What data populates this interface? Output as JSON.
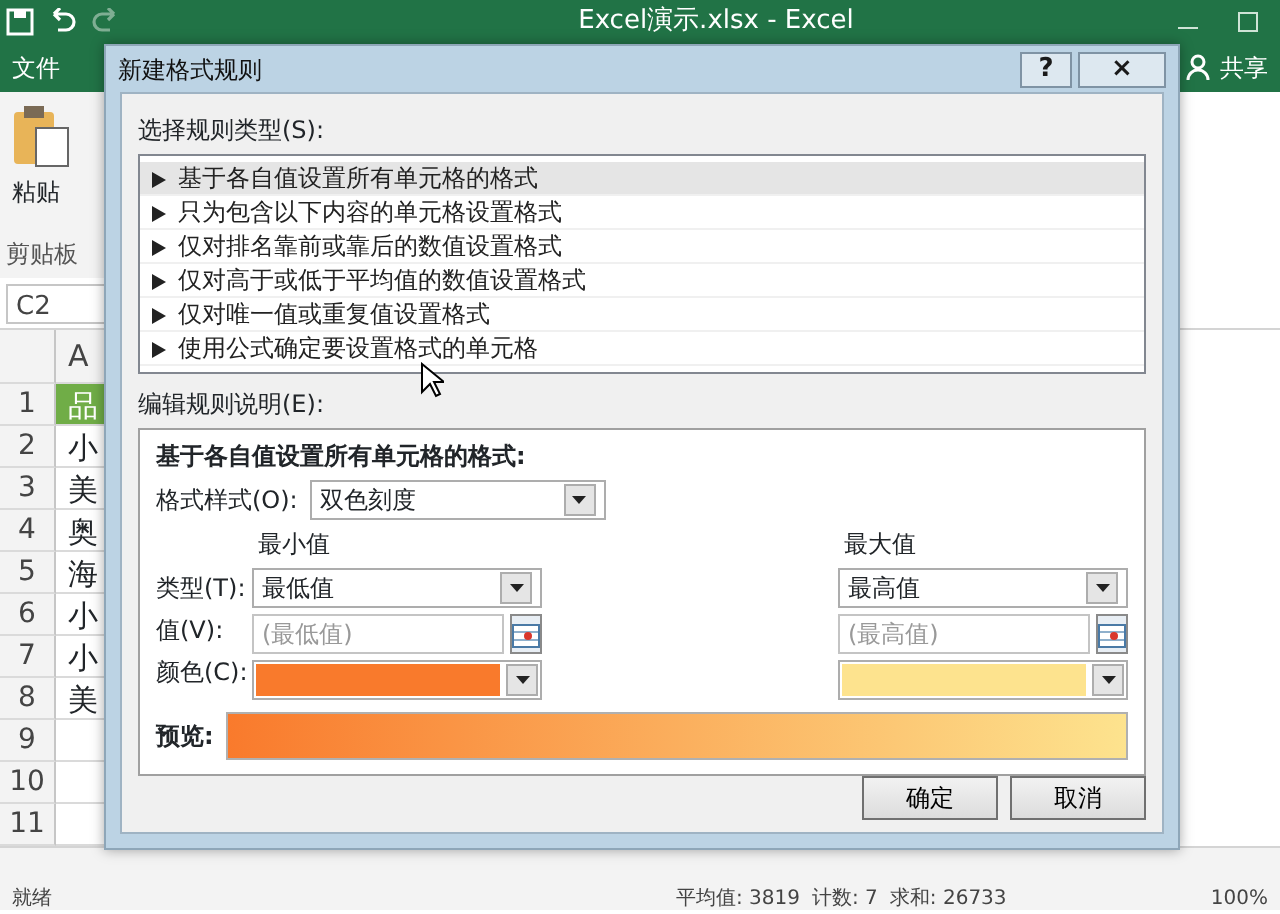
{
  "excel": {
    "title": "Excel演示.xlsx - Excel",
    "file_tab": "文件",
    "share": "共享",
    "paste": "粘贴",
    "clipboard_group": "剪贴板",
    "name_box": "C2",
    "column_header": "A",
    "rows": [
      {
        "number": "1",
        "cell": "品",
        "header": true
      },
      {
        "number": "2",
        "cell": "小",
        "header": false
      },
      {
        "number": "3",
        "cell": "美",
        "header": false
      },
      {
        "number": "4",
        "cell": "奥",
        "header": false
      },
      {
        "number": "5",
        "cell": "海",
        "header": false
      },
      {
        "number": "6",
        "cell": "小",
        "header": false
      },
      {
        "number": "7",
        "cell": "小",
        "header": false
      },
      {
        "number": "8",
        "cell": "美",
        "header": false
      },
      {
        "number": "9",
        "cell": "",
        "header": false
      },
      {
        "number": "10",
        "cell": "",
        "header": false
      },
      {
        "number": "11",
        "cell": "",
        "header": false
      }
    ],
    "status_bar": {
      "ready": "就绪",
      "average": "平均值: 3819",
      "count": "计数: 7",
      "sum": "求和: 26733",
      "zoom": "100%"
    }
  },
  "dialog": {
    "title": "新建格式规则",
    "help": "?",
    "close": "×",
    "rule_type_label": "选择规则类型(S):",
    "rule_types": [
      {
        "label": "基于各自值设置所有单元格的格式",
        "selected": true
      },
      {
        "label": "只为包含以下内容的单元格设置格式",
        "selected": false
      },
      {
        "label": "仅对排名靠前或靠后的数值设置格式",
        "selected": false
      },
      {
        "label": "仅对高于或低于平均值的数值设置格式",
        "selected": false
      },
      {
        "label": "仅对唯一值或重复值设置格式",
        "selected": false
      },
      {
        "label": "使用公式确定要设置格式的单元格",
        "selected": false
      }
    ],
    "edit_label": "编辑规则说明(E):",
    "description_title": "基于各自值设置所有单元格的格式:",
    "format_style_label": "格式样式(O):",
    "format_style": "双色刻度",
    "type_label": "类型(T):",
    "value_label": "值(V):",
    "color_label": "颜色(C):",
    "min": {
      "heading": "最小值",
      "type": "最低值",
      "value_placeholder": "(最低值)",
      "color": "#f97a2c"
    },
    "max": {
      "heading": "最大值",
      "type": "最高值",
      "value_placeholder": "(最高值)",
      "color": "#fde38e"
    },
    "preview_label": "预览:",
    "buttons": [
      "确定",
      "取消"
    ]
  }
}
